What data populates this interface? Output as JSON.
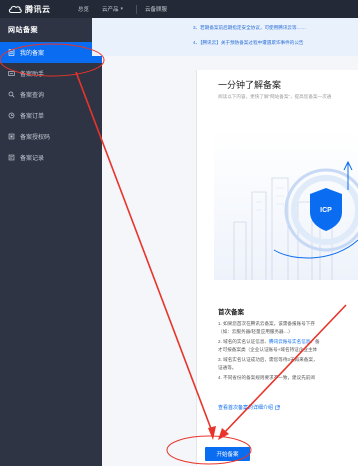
{
  "topbar": {
    "logo_text": "腾讯云",
    "nav": [
      {
        "label": "总览"
      },
      {
        "label": "云产品"
      },
      {
        "label": "云备顾服"
      }
    ]
  },
  "sidebar": {
    "title": "网站备案",
    "items": [
      {
        "label": "我的备案",
        "icon": "doc-icon",
        "active": true
      },
      {
        "label": "备案助手",
        "icon": "assistant-icon"
      },
      {
        "label": "备案查询",
        "icon": "search-icon"
      },
      {
        "label": "备案订单",
        "icon": "order-icon"
      },
      {
        "label": "备案授权码",
        "icon": "key-icon"
      },
      {
        "label": "备案记录",
        "icon": "record-icon"
      }
    ]
  },
  "notice": {
    "line1": "3、若期备案前后期指定安全协议，可使用腾讯云等……",
    "line2": "4、【腾讯云】关于预防备案过程中遭遇欺诈事件的公告"
  },
  "card": {
    "title": "一分钟了解备案",
    "subtitle": "阅读以下内容，更快了解“网站备案”，提高您备案一次通",
    "illustration_label": "ICP",
    "first_title": "首次备案",
    "steps": [
      {
        "text": "1. 如果您首次在腾讯云备案，该需备报账号下存",
        "link": ""
      },
      {
        "text": "（如：云服务器/轻量应用服务器…）",
        "link": ""
      },
      {
        "text": "2. 域名的实名认证信息、",
        "link": "腾讯云账号实名信息",
        "tail": "、备"
      },
      {
        "text": "才可按备案类（企业认证账号+域名持证企业主体",
        "link": ""
      },
      {
        "text": "3. 域名实名认证成功后，需您等待3天再来备案，",
        "link": ""
      },
      {
        "text": "证通等。",
        "link": ""
      },
      {
        "text": "4. 不同省份的备案规则要求不一致，建议先前阅",
        "link": ""
      }
    ],
    "detail_link": "查看首次备案的详细介绍",
    "start_button": "开始备案"
  },
  "colors": {
    "brand_blue": "#0a6cf0",
    "topbar_bg": "#232936",
    "sidebar_bg": "#2e3444",
    "annotation_red": "#e8342a"
  }
}
